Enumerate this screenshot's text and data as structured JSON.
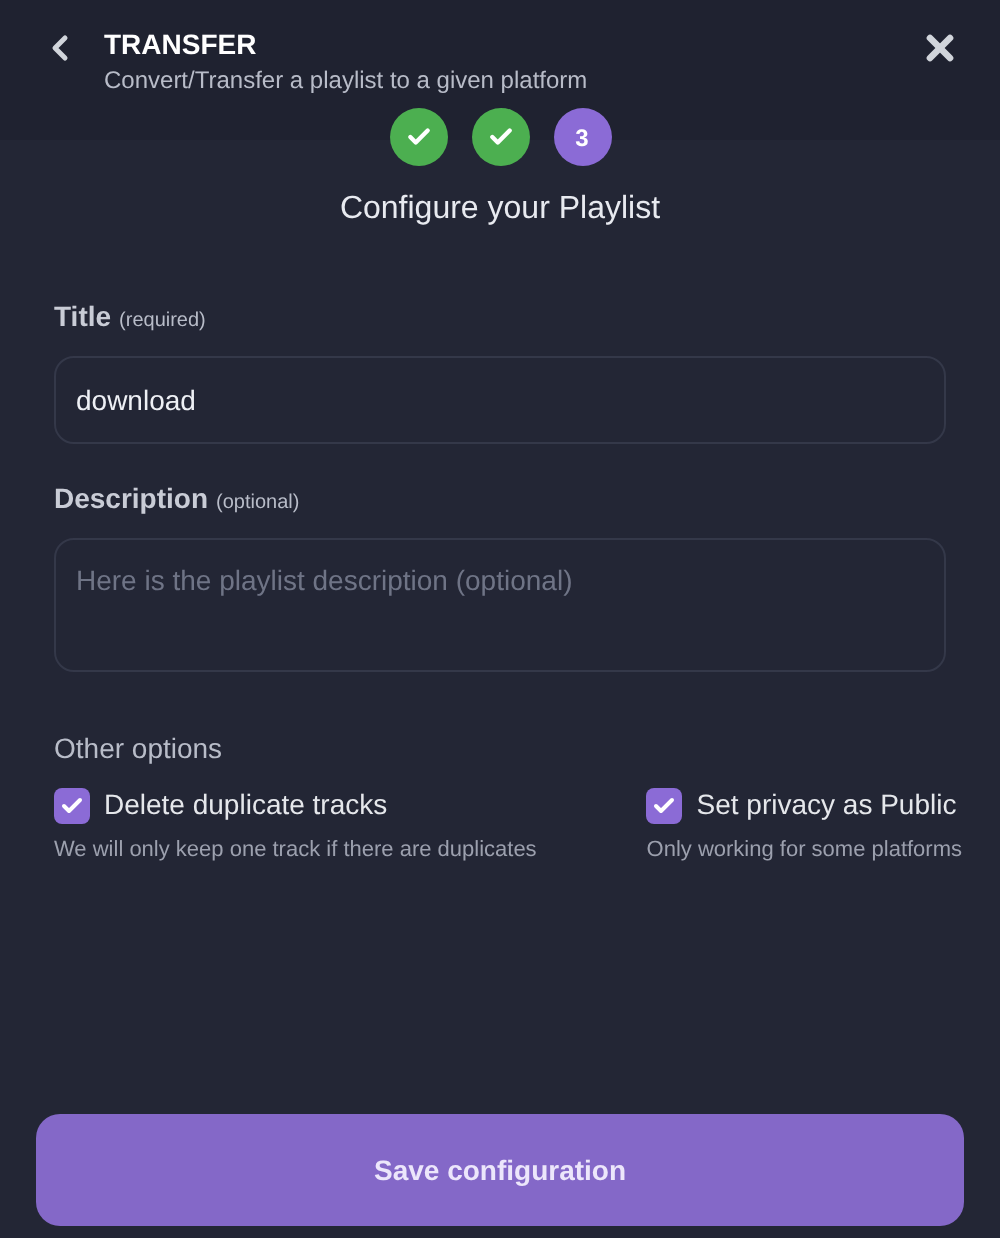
{
  "header": {
    "title": "TRANSFER",
    "subtitle": "Convert/Transfer a playlist to a given platform"
  },
  "steps": [
    {
      "done": true
    },
    {
      "done": true
    },
    {
      "done": false,
      "label": "3"
    }
  ],
  "heading": "Configure your Playlist",
  "fields": [
    {
      "label": "Title",
      "note": "(required)",
      "value": "download",
      "kind": "input"
    },
    {
      "label": "Description",
      "note": "(optional)",
      "placeholder": "Here is the playlist description (optional)",
      "kind": "textarea"
    }
  ],
  "options": {
    "title": "Other options",
    "items": [
      {
        "label": "Delete duplicate tracks",
        "hint": "We will only keep one track if there are duplicates",
        "checked": true
      },
      {
        "label": "Set privacy as Public",
        "hint": "Only working for some platforms",
        "checked": true
      }
    ]
  },
  "save_button": "Save configuration"
}
